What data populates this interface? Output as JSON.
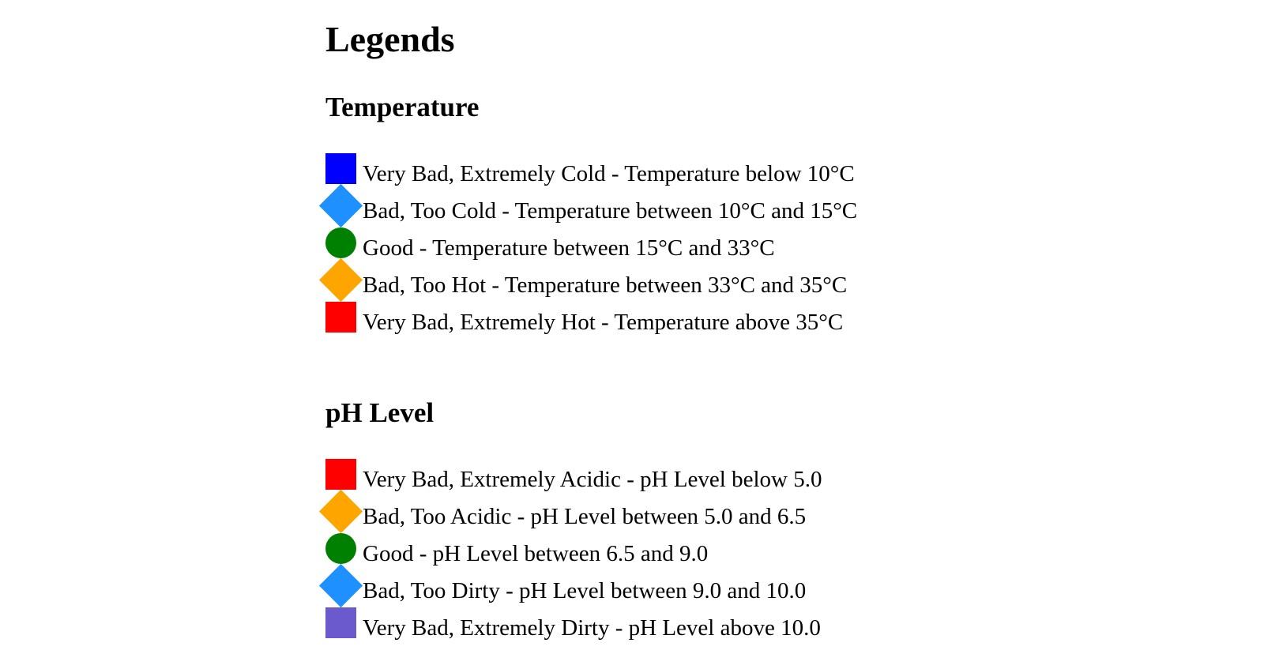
{
  "page": {
    "title": "Legends"
  },
  "sections": [
    {
      "title": "Temperature",
      "items": [
        {
          "label": "Very Bad, Extremely Cold - Temperature below 10°C",
          "shape": "square",
          "color": "#0000ff"
        },
        {
          "label": "Bad, Too Cold - Temperature between 10°C and 15°C",
          "shape": "diamond",
          "color": "#1e90ff"
        },
        {
          "label": "Good - Temperature between 15°C and 33°C",
          "shape": "circle",
          "color": "#008000"
        },
        {
          "label": "Bad, Too Hot - Temperature between 33°C and 35°C",
          "shape": "diamond",
          "color": "#ffa500"
        },
        {
          "label": "Very Bad, Extremely Hot - Temperature above 35°C",
          "shape": "square",
          "color": "#ff0000"
        }
      ]
    },
    {
      "title": "pH Level",
      "items": [
        {
          "label": "Very Bad, Extremely Acidic - pH Level below 5.0",
          "shape": "square",
          "color": "#ff0000"
        },
        {
          "label": "Bad, Too Acidic - pH Level between 5.0 and 6.5",
          "shape": "diamond",
          "color": "#ffa500"
        },
        {
          "label": "Good - pH Level between 6.5 and 9.0",
          "shape": "circle",
          "color": "#008000"
        },
        {
          "label": "Bad, Too Dirty - pH Level between 9.0 and 10.0",
          "shape": "diamond",
          "color": "#1e90ff"
        },
        {
          "label": "Very Bad, Extremely Dirty - pH Level above 10.0",
          "shape": "square",
          "color": "#6a5acd"
        }
      ]
    }
  ]
}
